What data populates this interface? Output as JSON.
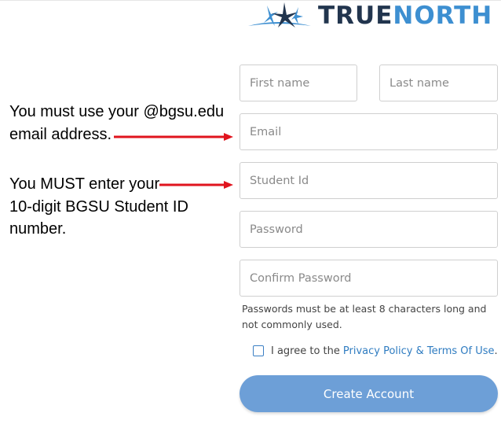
{
  "brand": {
    "word1": "TRUE",
    "word2": "NORTH",
    "colors": {
      "dark": "#22354e",
      "accent": "#3d8fd1"
    },
    "icon": "compass-star-icon"
  },
  "form": {
    "first_name": {
      "placeholder": "First name",
      "value": ""
    },
    "last_name": {
      "placeholder": "Last name",
      "value": ""
    },
    "email": {
      "placeholder": "Email",
      "value": ""
    },
    "student_id": {
      "placeholder": "Student Id",
      "value": ""
    },
    "password": {
      "placeholder": "Password",
      "value": ""
    },
    "confirm_password": {
      "placeholder": "Confirm Password",
      "value": ""
    },
    "password_hint": "Passwords must be at least 8 characters long and not commonly used.",
    "agree_prefix": "I agree to the",
    "agree_link": "Privacy Policy & Terms Of Use",
    "agree_suffix": ".",
    "agree_checked": false,
    "submit_label": "Create Account",
    "submit_color": "#6d9fd7"
  },
  "annotations": {
    "email_note": {
      "line1": "You must use your @bgsu.edu",
      "line2": "email address."
    },
    "id_note": {
      "line1": "You MUST enter your",
      "line2": "10-digit BGSU Student ID",
      "line3": "number."
    },
    "arrow_color": "#e0141e"
  }
}
